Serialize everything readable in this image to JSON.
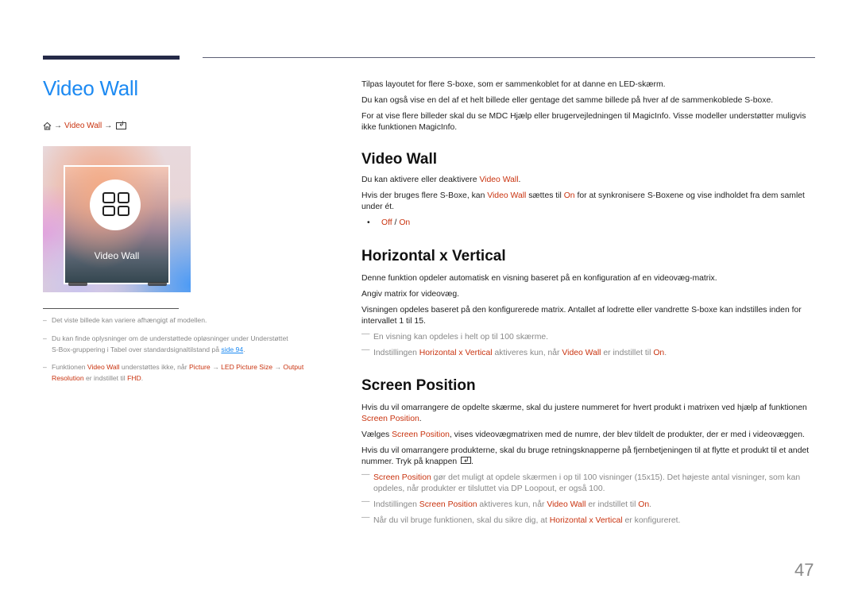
{
  "page": {
    "title": "Video Wall",
    "number": "47"
  },
  "breadcrumb": {
    "home_icon": "home-icon",
    "arrow": "→",
    "item": "Video Wall",
    "enter_icon": "enter-key-icon"
  },
  "hero": {
    "label": "Video Wall",
    "icon": "grid-four-squares-icon"
  },
  "notes": [
    {
      "dash": "–",
      "text": "Det viste billede kan variere afhængigt af modellen."
    },
    {
      "dash": "–",
      "text_1": "Du kan finde oplysninger om de understøttede opløsninger under Understøttet",
      "text_2": "S-Box-gruppering i Tabel over standardsignaltilstand på ",
      "link": "side 94",
      "text_3": "."
    },
    {
      "dash": "–",
      "t1": "Funktionen ",
      "r1": "Video Wall",
      "t2": " understøttes ikke, når ",
      "r2": "Picture",
      "a1": " → ",
      "r3": "LED Picture Size",
      "a2": " → ",
      "r4": "Output",
      "r5": "Resolution",
      "t3": " er indstillet til ",
      "r6": "FHD",
      "t4": "."
    }
  ],
  "intro": [
    "Tilpas layoutet for flere S-boxe, som er sammenkoblet for at danne en LED-skærm.",
    "Du kan også vise en del af et helt billede eller gentage det samme billede på hver af de sammenkoblede S-boxe.",
    "For at vise flere billeder skal du se MDC Hjælp eller brugervejledningen til MagicInfo. Visse modeller understøtter muligvis ikke funktionen MagicInfo."
  ],
  "section_video_wall": {
    "heading": "Video Wall",
    "p1": {
      "t1": "Du kan aktivere eller deaktivere ",
      "r1": "Video Wall",
      "t2": "."
    },
    "p2": {
      "t1": "Hvis der bruges flere S-Boxe, kan ",
      "r1": "Video Wall",
      "t2": " sættes til ",
      "r2": "On",
      "t3": " for at synkronisere S-Boxene og vise indholdet fra dem samlet under ét."
    },
    "options": {
      "off": "Off",
      "sep": " / ",
      "on": "On"
    }
  },
  "section_hv": {
    "heading": "Horizontal x Vertical",
    "p1": "Denne funktion opdeler automatisk en visning baseret på en konfiguration af en videovæg-matrix.",
    "p2": "Angiv matrix for videovæg.",
    "p3": "Visningen opdeles baseret på den konfigurerede matrix. Antallet af lodrette eller vandrette S-boxe kan indstilles inden for intervallet 1 til 15.",
    "n1": "En visning kan opdeles i helt op til 100 skærme.",
    "n2": {
      "t1": "Indstillingen ",
      "r1": "Horizontal x Vertical",
      "t2": " aktiveres kun, når ",
      "r2": "Video Wall",
      "t3": " er indstillet til ",
      "r3": "On",
      "t4": "."
    }
  },
  "section_sp": {
    "heading": "Screen Position",
    "p1": {
      "t1": "Hvis du vil omarrangere de opdelte skærme, skal du justere nummeret for hvert produkt i matrixen ved hjælp af funktionen ",
      "r1": "Screen Position",
      "t2": "."
    },
    "p2": {
      "t1": "Vælges ",
      "r1": "Screen Position",
      "t2": ", vises videovægmatrixen med de numre, der blev tildelt de produkter, der er med i videovæggen."
    },
    "p3": {
      "t1": "Hvis du vil omarrangere produkterne, skal du bruge retningsknapperne på fjernbetjeningen til at flytte et produkt til et andet nummer. Tryk på knappen ",
      "t2": "."
    },
    "n1": {
      "r1": "Screen Position",
      "t1": " gør det muligt at opdele skærmen i op til 100 visninger (15x15). Det højeste antal visninger, som kan opdeles, når produkter er tilsluttet via DP Loopout, er også 100."
    },
    "n2": {
      "t1": "Indstillingen ",
      "r1": "Screen Position",
      "t2": " aktiveres kun, når ",
      "r2": "Video Wall",
      "t3": " er indstillet til ",
      "r3": "On",
      "t4": "."
    },
    "n3": {
      "t1": "Når du vil bruge funktionen, skal du sikre dig, at ",
      "r1": "Horizontal x Vertical",
      "t2": " er konfigureret."
    }
  },
  "note_mark": "—",
  "colors": {
    "title_blue": "#1d8af2",
    "highlight_red": "#c9330f",
    "rule_navy": "#252a48"
  }
}
